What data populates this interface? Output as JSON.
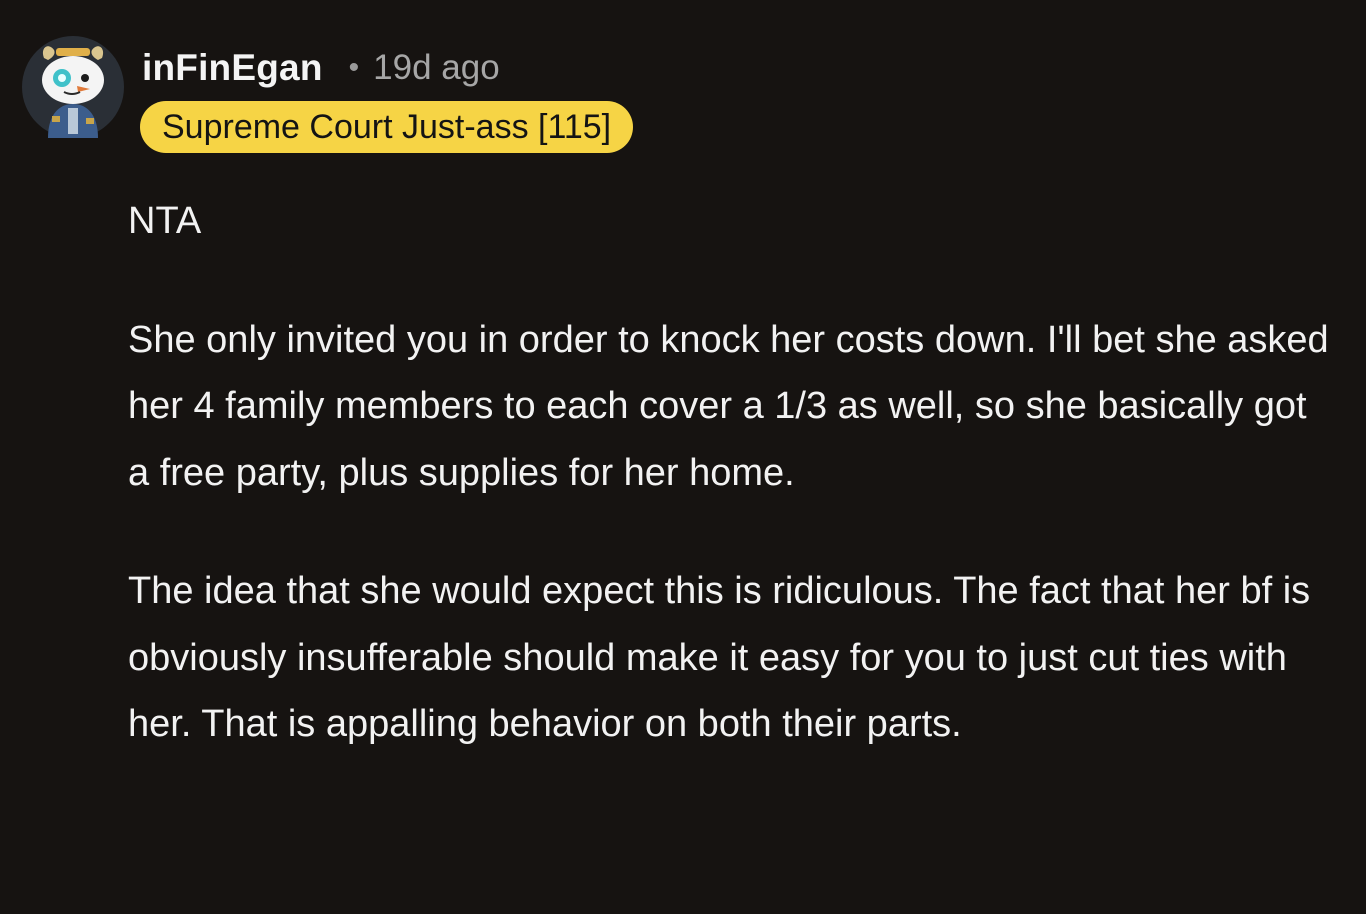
{
  "comment": {
    "username": "inFinEgan",
    "separator": "•",
    "timestamp": "19d ago",
    "flair": "Supreme Court Just-ass [115]",
    "avatar_icon": "snoo-avatar-icon",
    "paragraphs": [
      "NTA",
      "She only invited you in order to knock her costs down. I'll bet she asked her 4 family members to each cover a 1/3 as well, so she basically got a free party, plus supplies for her home.",
      "The idea that she would expect this is ridiculous. The fact that her bf is obviously insufferable should make it easy for you to just cut ties with her. That is appalling behavior on both their parts."
    ]
  },
  "colors": {
    "background": "#161311",
    "flair_background": "#f6d445",
    "text": "#f2f2f2",
    "meta": "#a6a6a6"
  }
}
